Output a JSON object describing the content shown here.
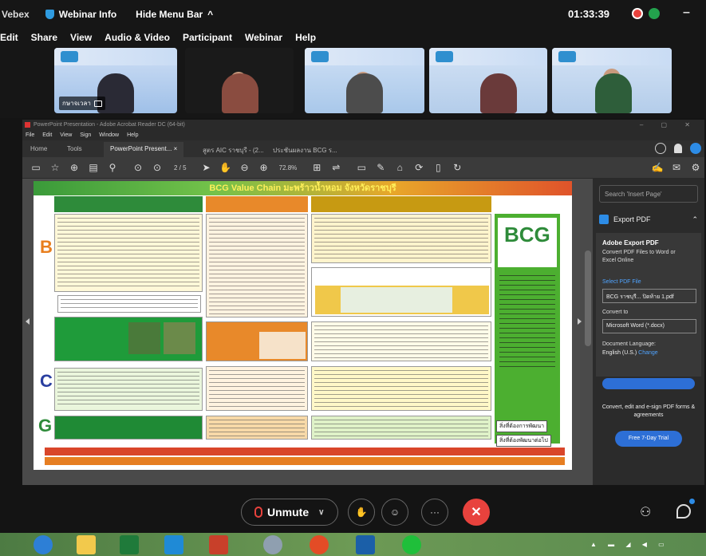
{
  "webex": {
    "app_fragment": "Vebex",
    "webinar_info": "Webinar Info",
    "hide_menu_bar": "Hide Menu Bar",
    "hide_caret": "^",
    "clock": "01:33:39",
    "minimize": "–"
  },
  "menu": [
    "Edit",
    "Share",
    "View",
    "Audio & Video",
    "Participant",
    "Webinar",
    "Help"
  ],
  "participants": [
    {
      "name": "กษาจเวลา",
      "has_tag": true
    },
    {
      "name": "",
      "has_tag": false
    },
    {
      "name": "",
      "has_tag": false
    },
    {
      "name": "",
      "has_tag": false
    },
    {
      "name": "",
      "has_tag": false
    }
  ],
  "acrobat": {
    "title": "PowerPoint Presentation - Adobe Acrobat Reader DC (64-bit)",
    "window_controls": "– ▢ ✕",
    "menu": [
      "File",
      "Edit",
      "View",
      "Sign",
      "Window",
      "Help"
    ],
    "tabs": [
      "Home",
      "Tools",
      "PowerPoint Present... ×",
      "สูตร AIC ราชบุรี - (2...",
      "ประชันผลงาน BCG ร..."
    ],
    "page_indicator": "2 / 5",
    "zoom": "72.8%"
  },
  "slide": {
    "title": "BCG Value Chain มะพร้าวน้ำหอม จังหวัดราชบุรี",
    "letters": [
      "B",
      "C",
      "G"
    ],
    "logo": "BCG",
    "buttons": [
      "สิ่งที่ต้องการพัฒนา",
      "สิ่งที่ต้องพัฒนาต่อไป"
    ]
  },
  "export_panel": {
    "search_placeholder": "Search 'Insert Page'",
    "export_title": "Export PDF",
    "box_title": "Adobe Export PDF",
    "box_sub": "Convert PDF Files to Word or Excel Online",
    "select_label": "Select PDF File",
    "file_name": "BCG ราชบุรี... ปิดท้าย 1.pdf",
    "convert_label": "Convert to",
    "convert_value": "Microsoft Word (*.docx)",
    "lang_label": "Document Language:",
    "lang_value": "English (U.S.)",
    "lang_change": "Change",
    "promo": "Convert, edit and e-sign PDF forms & agreements",
    "trial": "Free 7-Day Trial"
  },
  "controls": {
    "unmute": "Unmute"
  },
  "colors": {
    "accent": "#2d8ce6",
    "end_call": "#e8423d",
    "slide_green": "#2e8b3a",
    "slide_orange": "#e8892a"
  }
}
